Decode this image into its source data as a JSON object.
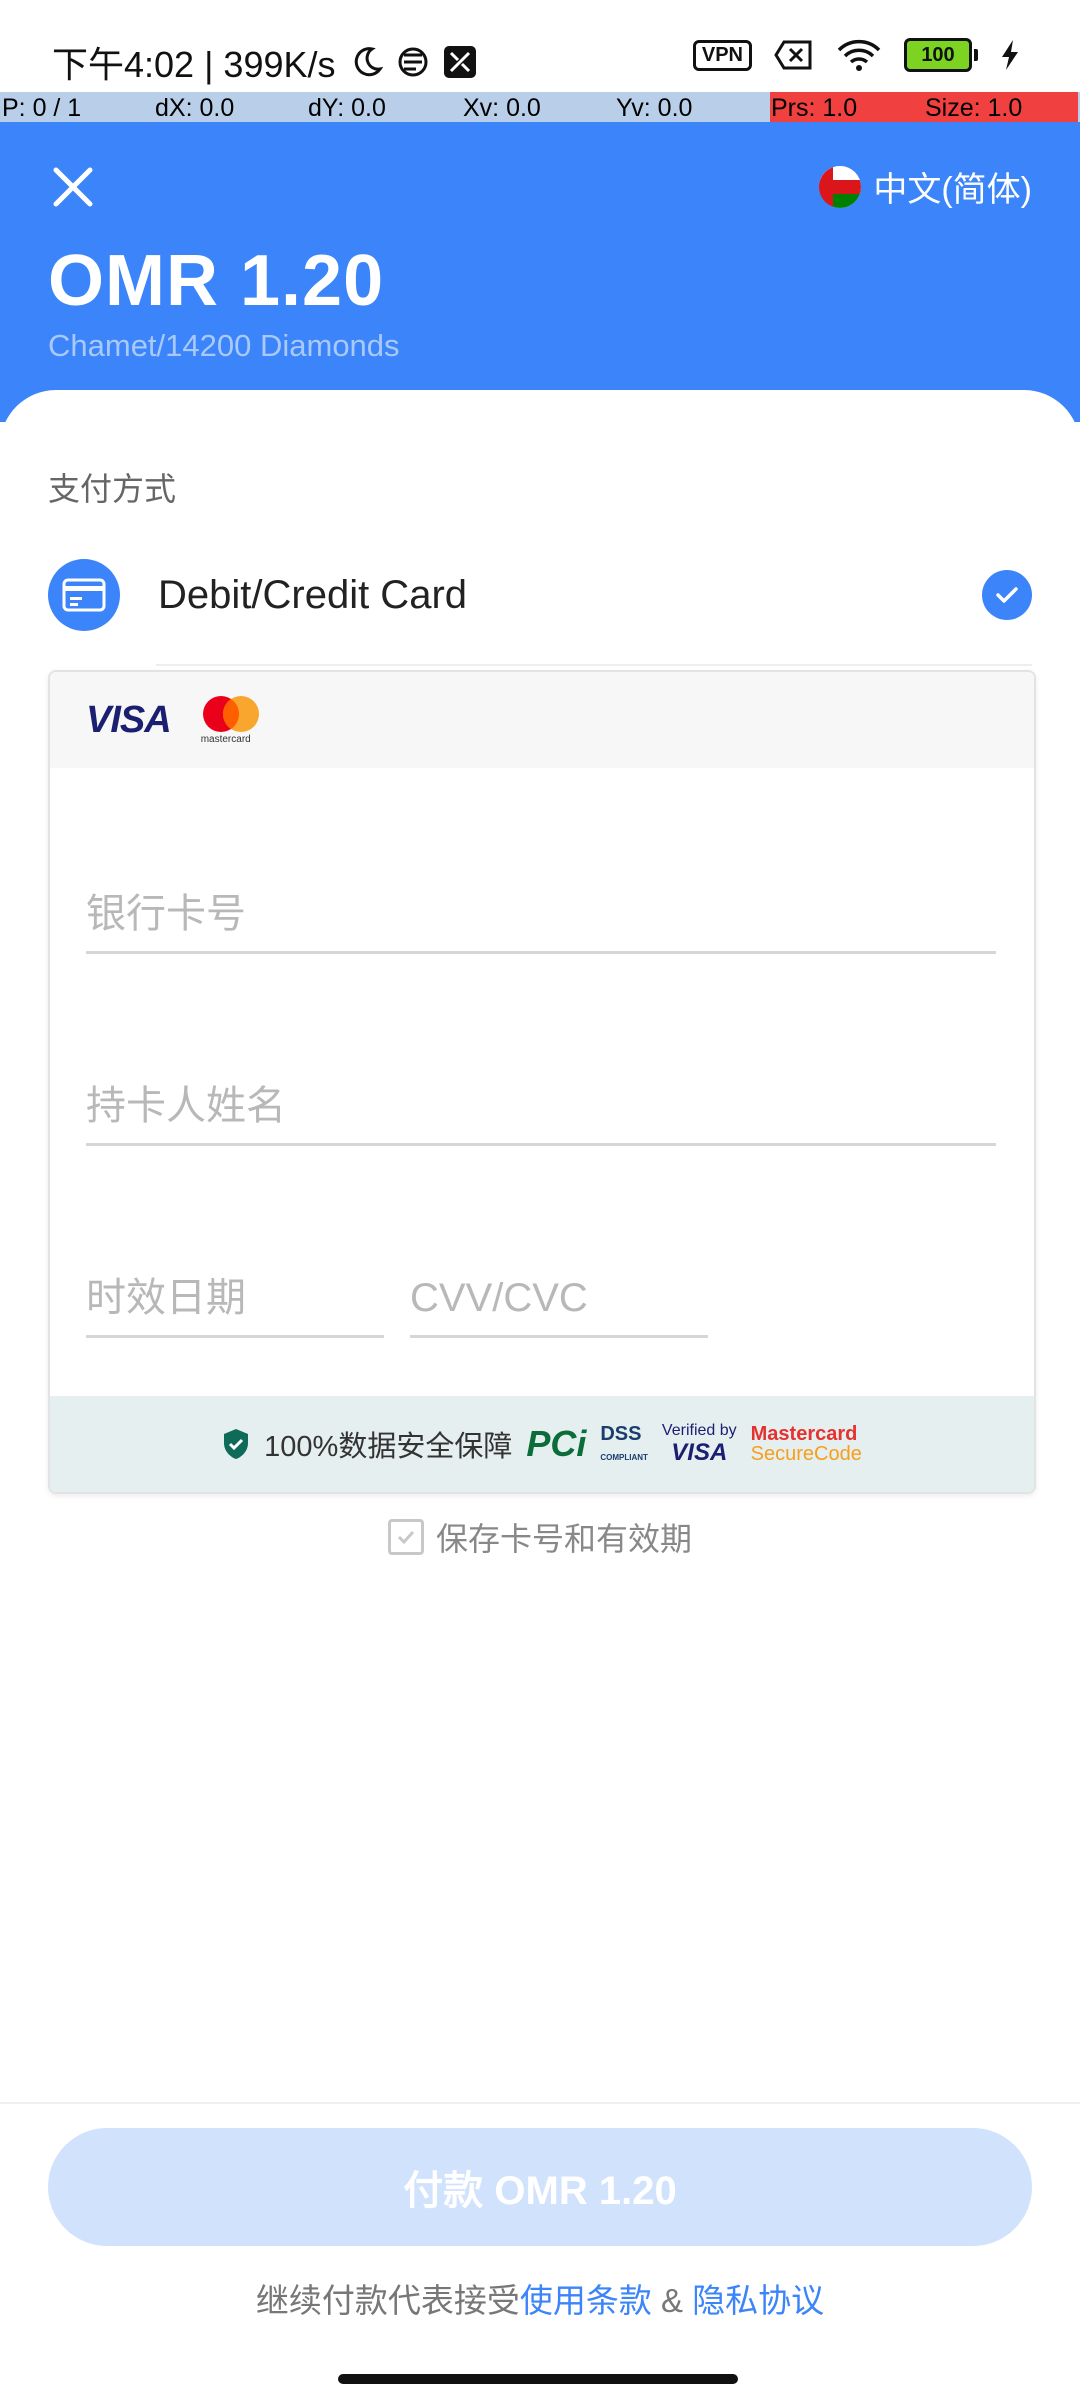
{
  "status_bar": {
    "time_speed": "下午4:02 | 399K/s",
    "vpn_label": "VPN",
    "battery": "100",
    "icons": [
      "moon-icon",
      "notification-icon",
      "nfc-icon",
      "vpn-icon",
      "sim-off-icon",
      "wifi-icon",
      "battery-icon",
      "charging-icon"
    ]
  },
  "debug_bar": {
    "p": "P: 0 / 1",
    "dx": "dX: 0.0",
    "dy": "dY: 0.0",
    "xv": "Xv: 0.0",
    "yv": "Yv: 0.0",
    "prs": "Prs: 1.0",
    "size": "Size: 1.0"
  },
  "header": {
    "language": "中文(简体)",
    "amount": "OMR 1.20",
    "product": "Chamet/14200 Diamonds",
    "accent_color": "#3b84fa"
  },
  "payment": {
    "section_title": "支付方式",
    "method_label": "Debit/Credit Card",
    "brands": {
      "visa": "VISA",
      "mastercard": "mastercard"
    },
    "fields": {
      "card_number_placeholder": "银行卡号",
      "holder_name_placeholder": "持卡人姓名",
      "expiry_placeholder": "时效日期",
      "cvv_placeholder": "CVV/CVC"
    },
    "security": {
      "text": "100%数据安全保障",
      "pci": "PCi",
      "dss_top": "DSS",
      "dss_bottom": "COMPLIANT",
      "vbv_top": "Verified by",
      "vbv_bottom": "VISA",
      "mcsc_top": "Mastercard",
      "mcsc_bottom": "SecureCode"
    },
    "save_label": "保存卡号和有效期"
  },
  "footer": {
    "pay_button": "付款 OMR 1.20",
    "terms_prefix": "继续付款代表接受",
    "terms_link": "使用条款",
    "terms_amp": " & ",
    "privacy_link": "隐私协议"
  }
}
